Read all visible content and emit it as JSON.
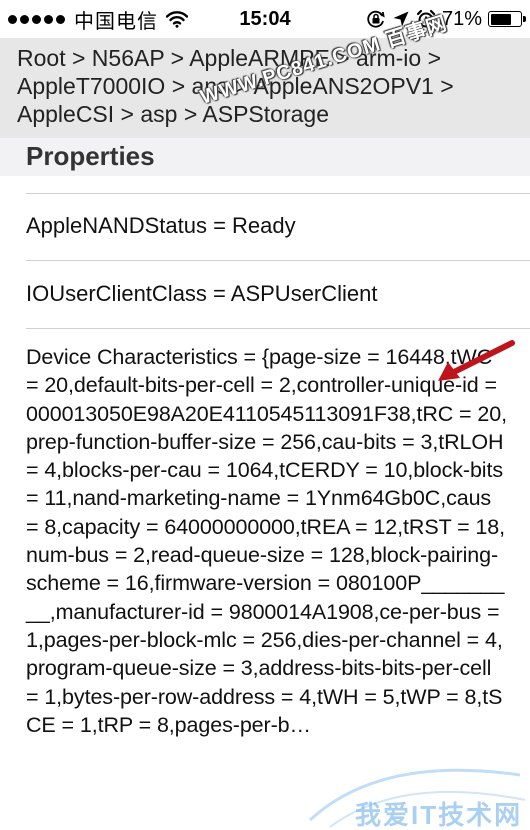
{
  "status_bar": {
    "carrier": "中国电信",
    "time": "15:04",
    "battery_percent": "71%",
    "battery_level": 0.71,
    "signal_dots": 5,
    "icons": [
      "wifi-icon",
      "rotation-lock-icon",
      "location-arrow-icon",
      "alarm-icon",
      "battery-icon"
    ]
  },
  "breadcrumb": {
    "text": "Root > N56AP > AppleARMPE > arm-io > AppleT7000IO > ans > AppleANS2OPV1 > AppleCSI > asp > ASPStorage"
  },
  "watermark": {
    "text": "WWW.PC841.COM 百事网"
  },
  "section": {
    "title": "Properties"
  },
  "properties": [
    {
      "text": "AppleNANDStatus = Ready"
    },
    {
      "text": "IOUserClientClass = ASPUserClient"
    },
    {
      "text": "Device Characteristics = {page-size = 16448,tWC = 20,default-bits-per-cell = 2,controller-unique-id = 000013050E98A20E4110545113091F38,tRC = 20,prep-function-buffer-size = 256,cau-bits = 3,tRLOH = 4,blocks-per-cau = 1064,tCERDY = 10,block-bits = 11,nand-marketing-name = 1Ynm64Gb0C,caus = 8,capacity = 64000000000,tREA = 12,tRST = 18,num-bus = 2,read-queue-size = 128,block-pairing-scheme = 16,firmware-version = 080100P_________,manufacturer-id = 9800014A1908,ce-per-bus = 1,pages-per-block-mlc = 256,dies-per-channel = 4,program-queue-size = 3,address-bits-bits-per-cell = 1,bytes-per-row-address = 4,tWH = 5,tWP = 8,tSCE = 1,tRP = 8,pages-per-b…"
    }
  ],
  "annotation": {
    "arrow_color": "#c0141c"
  },
  "corner_watermark": {
    "text": "我爱IT技术网"
  }
}
